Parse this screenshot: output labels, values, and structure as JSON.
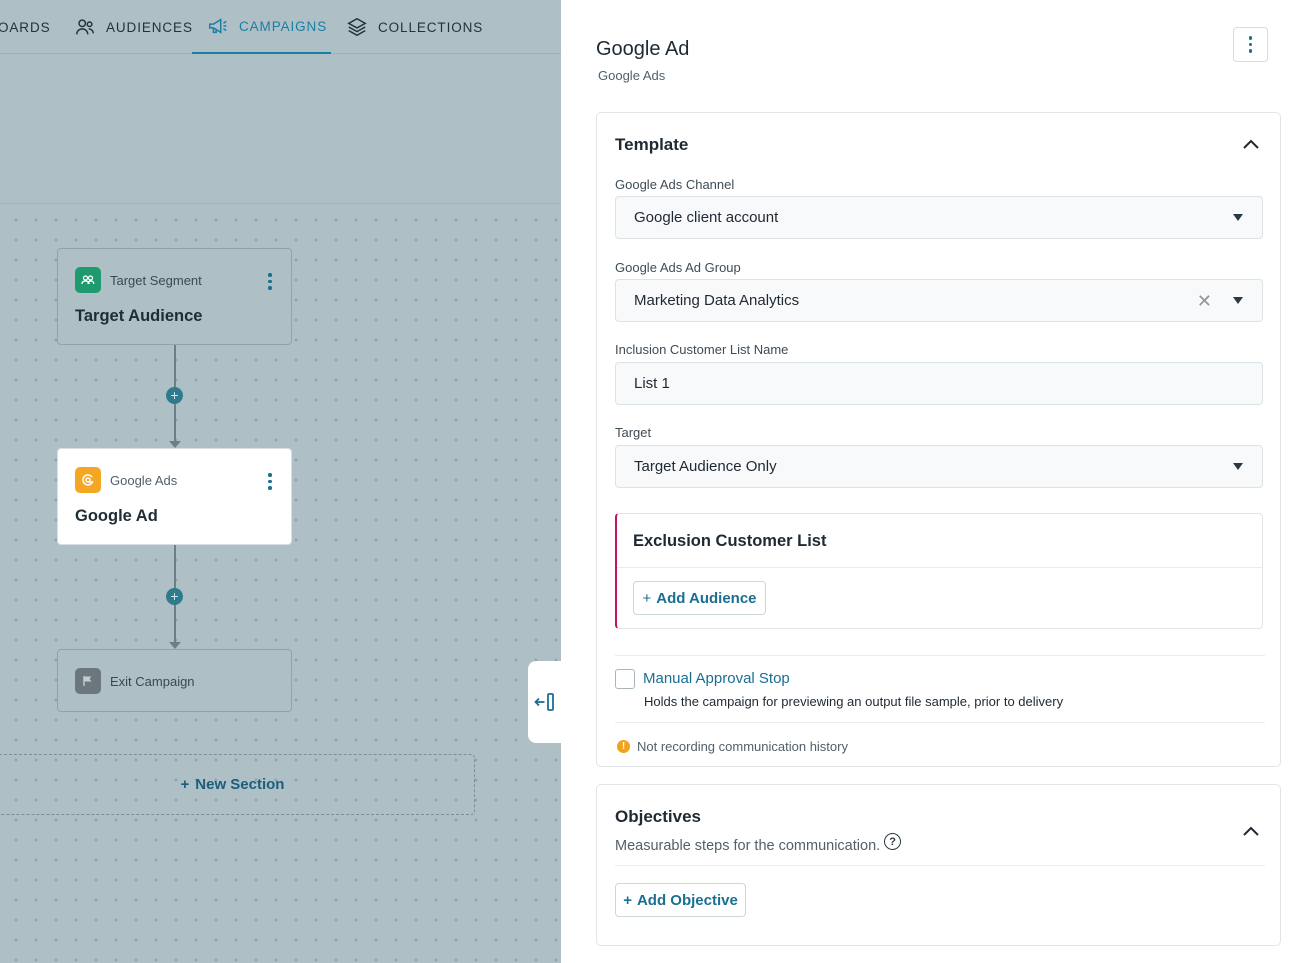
{
  "nav": {
    "items": [
      {
        "label": "OARDS",
        "icon": "dashboard-icon"
      },
      {
        "label": "AUDIENCES",
        "icon": "audiences-icon"
      },
      {
        "label": "CAMPAIGNS",
        "icon": "megaphone-icon",
        "active": true
      },
      {
        "label": "COLLECTIONS",
        "icon": "layers-icon"
      }
    ]
  },
  "canvas": {
    "nodes": [
      {
        "type": "Target Segment",
        "title": "Target Audience",
        "icon": "segment-icon",
        "icon_color": "#1f9a6e"
      },
      {
        "type": "Google Ads",
        "title": "Google Ad",
        "icon": "google-ads-icon",
        "icon_color": "#f5a623",
        "selected": true
      },
      {
        "type": "Exit Campaign",
        "icon": "flag-icon",
        "icon_color": "#6b777d"
      }
    ],
    "new_section_label": "New Section"
  },
  "panel": {
    "title": "Google Ad",
    "subtitle": "Google Ads",
    "template": {
      "title": "Template",
      "fields": {
        "channel": {
          "label": "Google Ads Channel",
          "value": "Google client account"
        },
        "ad_group": {
          "label": "Google Ads Ad Group",
          "value": "Marketing Data Analytics"
        },
        "list_name": {
          "label": "Inclusion Customer List Name",
          "value": "List 1"
        },
        "target": {
          "label": "Target",
          "value": "Target Audience Only"
        }
      },
      "exclusion": {
        "title": "Exclusion Customer List",
        "add_label": "Add Audience"
      },
      "manual_approval": {
        "label": "Manual Approval Stop",
        "description": "Holds the campaign for previewing an output file sample, prior to delivery",
        "checked": false
      },
      "warning": "Not recording communication history"
    },
    "objectives": {
      "title": "Objectives",
      "subtitle": "Measurable steps for the communication.",
      "add_label": "Add Objective"
    }
  },
  "colors": {
    "accent": "#1a7fa2",
    "exclusion_border": "#c0155a",
    "warning": "#f2a21b"
  }
}
